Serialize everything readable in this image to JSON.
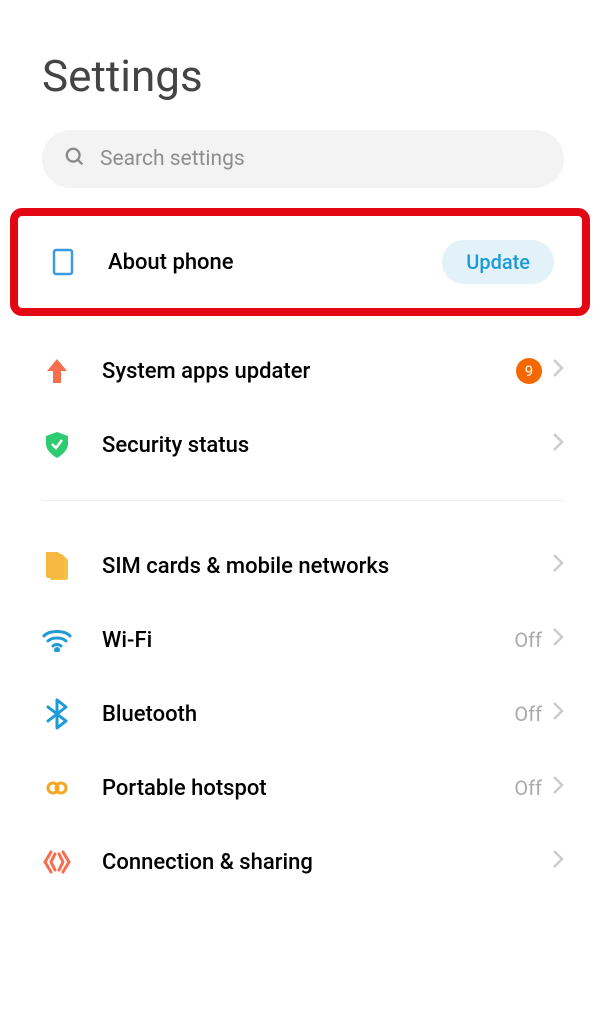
{
  "page_title": "Settings",
  "search": {
    "placeholder": "Search settings"
  },
  "items": {
    "about_phone": {
      "label": "About phone",
      "badge": "Update"
    },
    "system_apps": {
      "label": "System apps updater",
      "count": "9"
    },
    "security": {
      "label": "Security status"
    },
    "sim": {
      "label": "SIM cards & mobile networks"
    },
    "wifi": {
      "label": "Wi-Fi",
      "status": "Off"
    },
    "bluetooth": {
      "label": "Bluetooth",
      "status": "Off"
    },
    "hotspot": {
      "label": "Portable hotspot",
      "status": "Off"
    },
    "connection": {
      "label": "Connection & sharing"
    }
  }
}
